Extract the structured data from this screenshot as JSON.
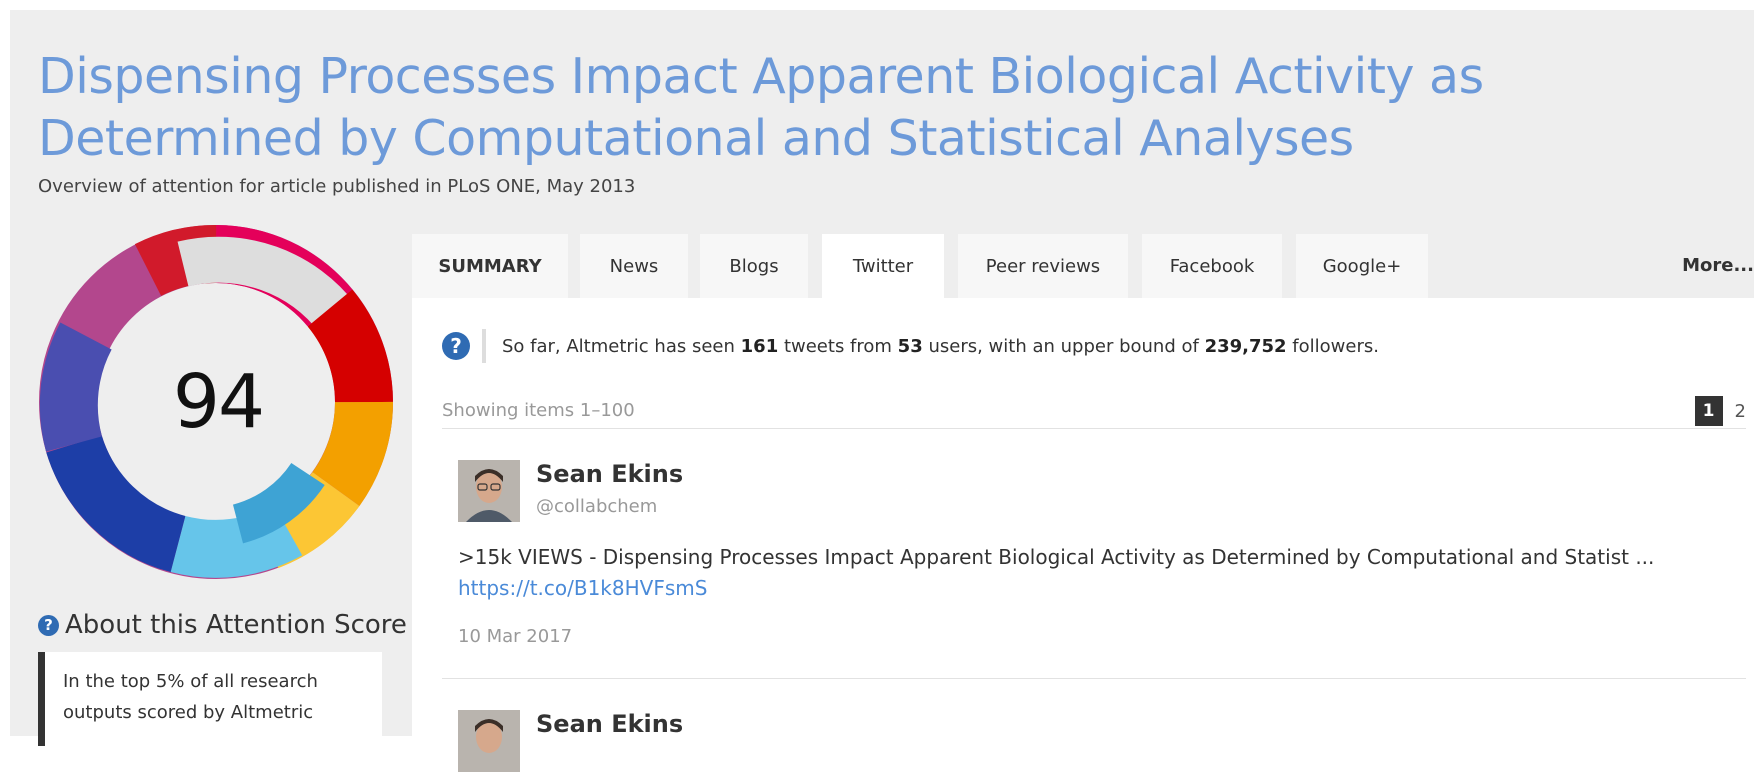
{
  "article": {
    "title": "Dispensing Processes Impact Apparent Biological Activity as Determined by Computational and Statistical Analyses",
    "subtitle": "Overview of attention for article published in PLoS ONE, May 2013"
  },
  "score": {
    "value": "94",
    "about_title": "About this Attention Score",
    "about_text": "In the top 5% of all research outputs scored by Altmetric",
    "colors": [
      "#e4005a",
      "#d11a2b",
      "#dddddd",
      "#d50000",
      "#f3a000",
      "#fcc634",
      "#3ea3d4",
      "#66c5ea",
      "#1d3ea7",
      "#4a4eb0",
      "#b3478d"
    ]
  },
  "tabs": [
    {
      "label": "SUMMARY"
    },
    {
      "label": "News"
    },
    {
      "label": "Blogs"
    },
    {
      "label": "Twitter"
    },
    {
      "label": "Peer reviews"
    },
    {
      "label": "Facebook"
    },
    {
      "label": "Google+"
    }
  ],
  "more_label": "More...",
  "twitter": {
    "summary_prefix": "So far, Altmetric has seen",
    "tweets": "161",
    "tweets_suffix": "tweets from",
    "users": "53",
    "users_suffix": "users, with an upper bound of",
    "followers": "239,752",
    "followers_suffix": "followers.",
    "showing": "Showing items 1–100",
    "pages": [
      "1",
      "2"
    ],
    "items": [
      {
        "name": "Sean Ekins",
        "handle": "@collabchem",
        "text": ">15k VIEWS - Dispensing Processes Impact Apparent Biological Activity as Determined by Computational and Statist ...",
        "link": "https://t.co/B1k8HVFsmS",
        "date": "10 Mar 2017"
      },
      {
        "name": "Sean Ekins"
      }
    ]
  }
}
